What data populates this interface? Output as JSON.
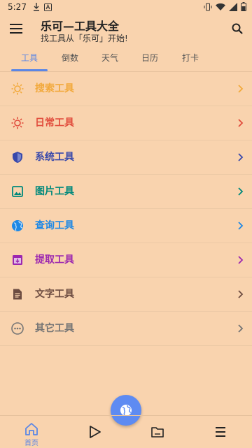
{
  "status": {
    "time": "5:27"
  },
  "header": {
    "title": "乐可—工具大全",
    "subtitle": "找工具从「乐可」开始!"
  },
  "tabs": [
    {
      "label": "工具",
      "active": true
    },
    {
      "label": "倒数",
      "active": false
    },
    {
      "label": "天气",
      "active": false
    },
    {
      "label": "日历",
      "active": false
    },
    {
      "label": "打卡",
      "active": false
    }
  ],
  "categories": [
    {
      "label": "搜索工具",
      "icon": "sun-icon",
      "color": "#F2A93B"
    },
    {
      "label": "日常工具",
      "icon": "sun-icon",
      "color": "#E14C3C"
    },
    {
      "label": "系统工具",
      "icon": "shield-icon",
      "color": "#3949AB"
    },
    {
      "label": "图片工具",
      "icon": "image-icon",
      "color": "#00897B"
    },
    {
      "label": "查询工具",
      "icon": "globe-icon",
      "color": "#1E88E5"
    },
    {
      "label": "提取工具",
      "icon": "archive-icon",
      "color": "#9C27B0"
    },
    {
      "label": "文字工具",
      "icon": "document-icon",
      "color": "#6D4C41"
    },
    {
      "label": "其它工具",
      "icon": "more-icon",
      "color": "#757575"
    }
  ],
  "bottom_nav": [
    {
      "label": "首页",
      "icon": "home-icon",
      "active": true
    },
    {
      "label": "",
      "icon": "play-icon",
      "active": false
    },
    {
      "label": "",
      "icon": "folder-icon",
      "active": false
    },
    {
      "label": "",
      "icon": "menu-icon",
      "active": false
    }
  ],
  "colors": {
    "background": "#F9D3AE",
    "accent": "#5B86E5",
    "fab": "#5E8BF2"
  }
}
